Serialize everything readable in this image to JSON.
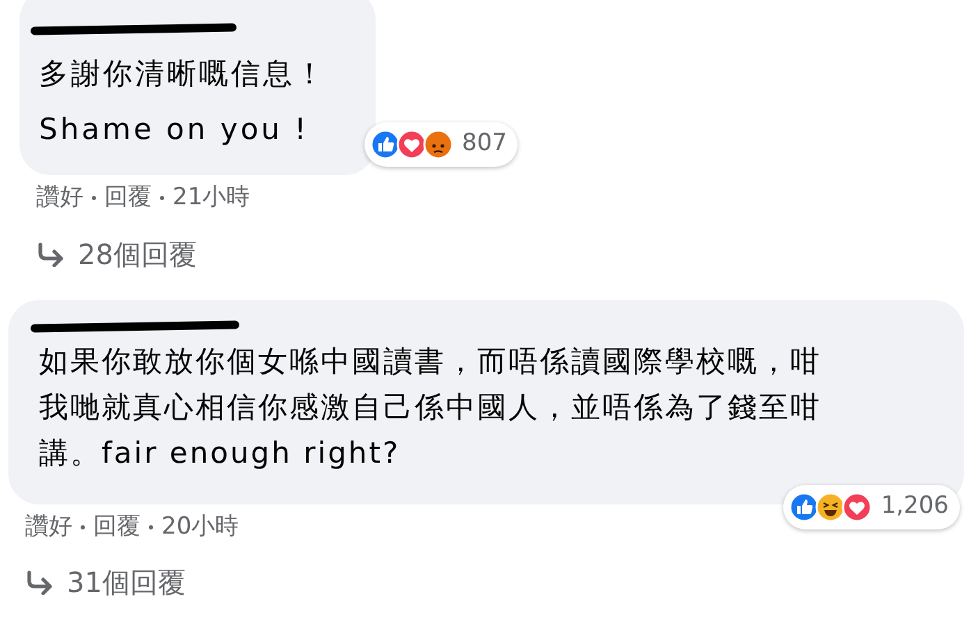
{
  "comments": [
    {
      "author_redacted": true,
      "lines": [
        "多謝你清晰嘅信息！",
        "Shame on you !"
      ],
      "reactions": [
        {
          "kind": "like"
        },
        {
          "kind": "love"
        },
        {
          "kind": "angry"
        }
      ],
      "reaction_count": "807",
      "actions": [
        "讚好",
        "回覆",
        "21小時"
      ],
      "replies": "28個回覆"
    },
    {
      "author_redacted": true,
      "lines": [
        "如果你敢放你個女喺中國讀書，而唔係讀國際學校嘅，咁",
        "我哋就真心相信你感激自己係中國人，並唔係為了錢至咁",
        "講。fair enough right?"
      ],
      "reactions": [
        {
          "kind": "like"
        },
        {
          "kind": "haha"
        },
        {
          "kind": "love"
        }
      ],
      "reaction_count": "1,206",
      "actions": [
        "讚好",
        "回覆",
        "20小時"
      ],
      "replies": "31個回覆"
    }
  ]
}
